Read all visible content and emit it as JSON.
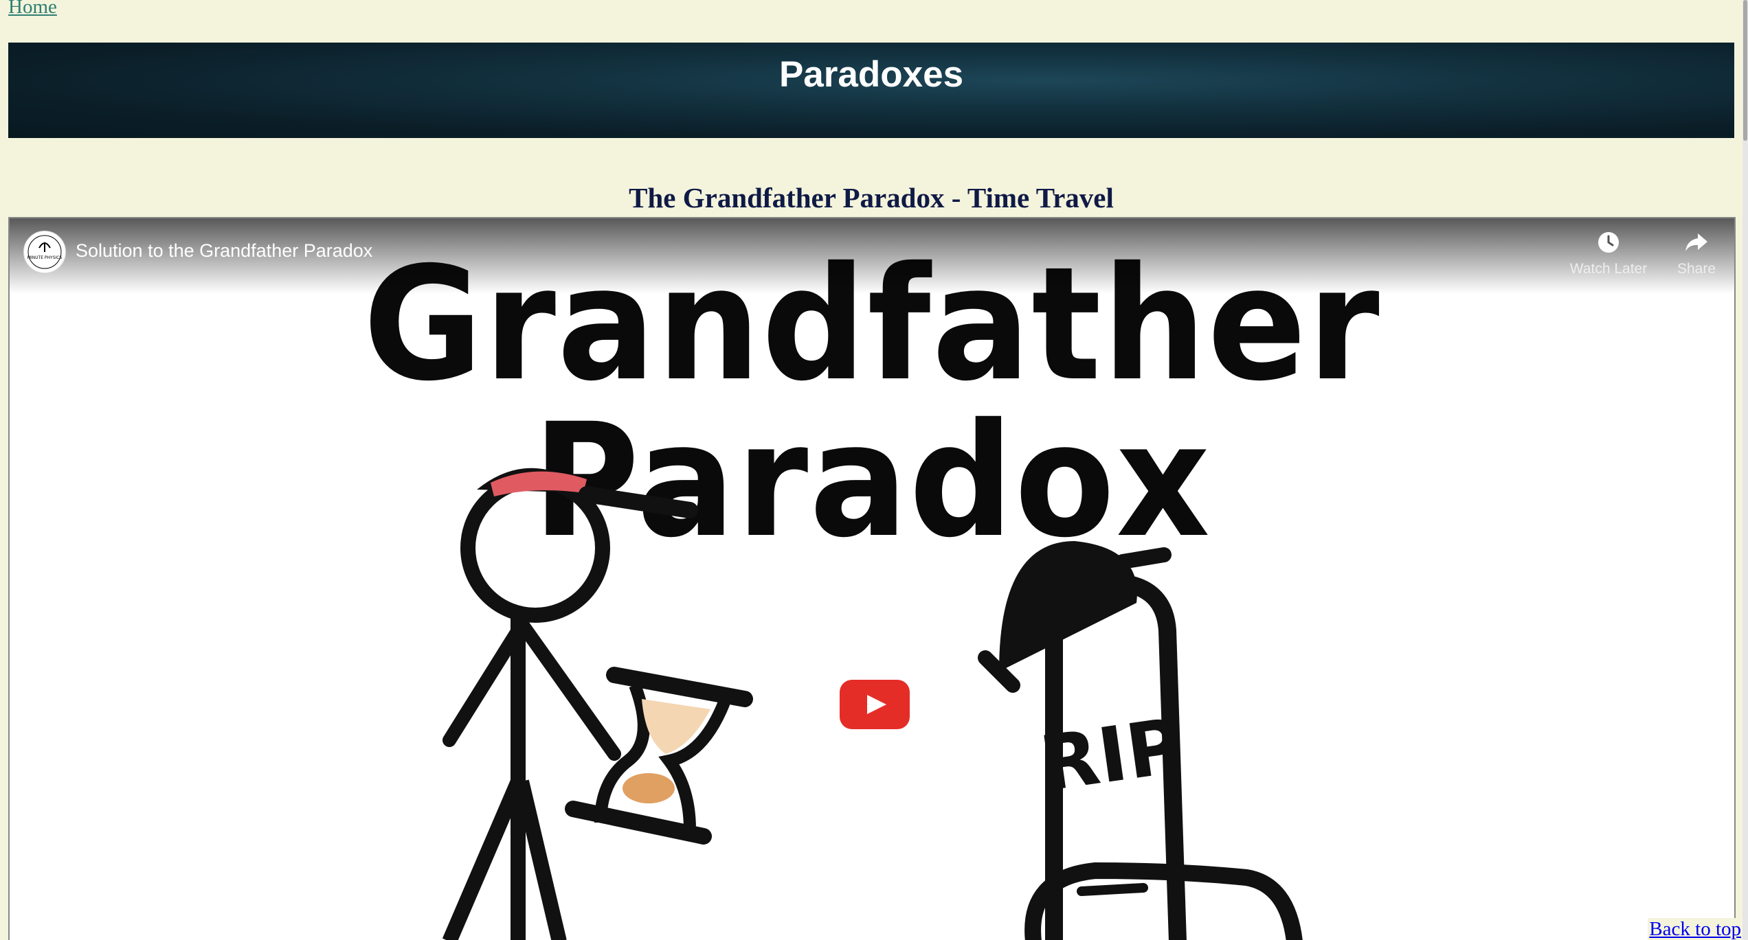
{
  "nav": {
    "home_label": "Home"
  },
  "banner": {
    "title": "Paradoxes"
  },
  "section": {
    "heading": "The Grandfather Paradox - Time Travel"
  },
  "video": {
    "title": "Solution to the Grandfather Paradox",
    "channel_avatar_text": "MINUTE PHYSICS",
    "watch_later_label": "Watch Later",
    "share_label": "Share",
    "thumbnail_heading": "Grandfather Paradox",
    "tombstone_text": "RIP",
    "play_button_color": "#e52d27"
  },
  "footer": {
    "back_to_top_label": "Back to top"
  },
  "colors": {
    "page_background": "#f4f4dc",
    "heading_color": "#0f1a46",
    "home_link_color": "#2f7f74",
    "back_link_color": "#0000ee"
  }
}
